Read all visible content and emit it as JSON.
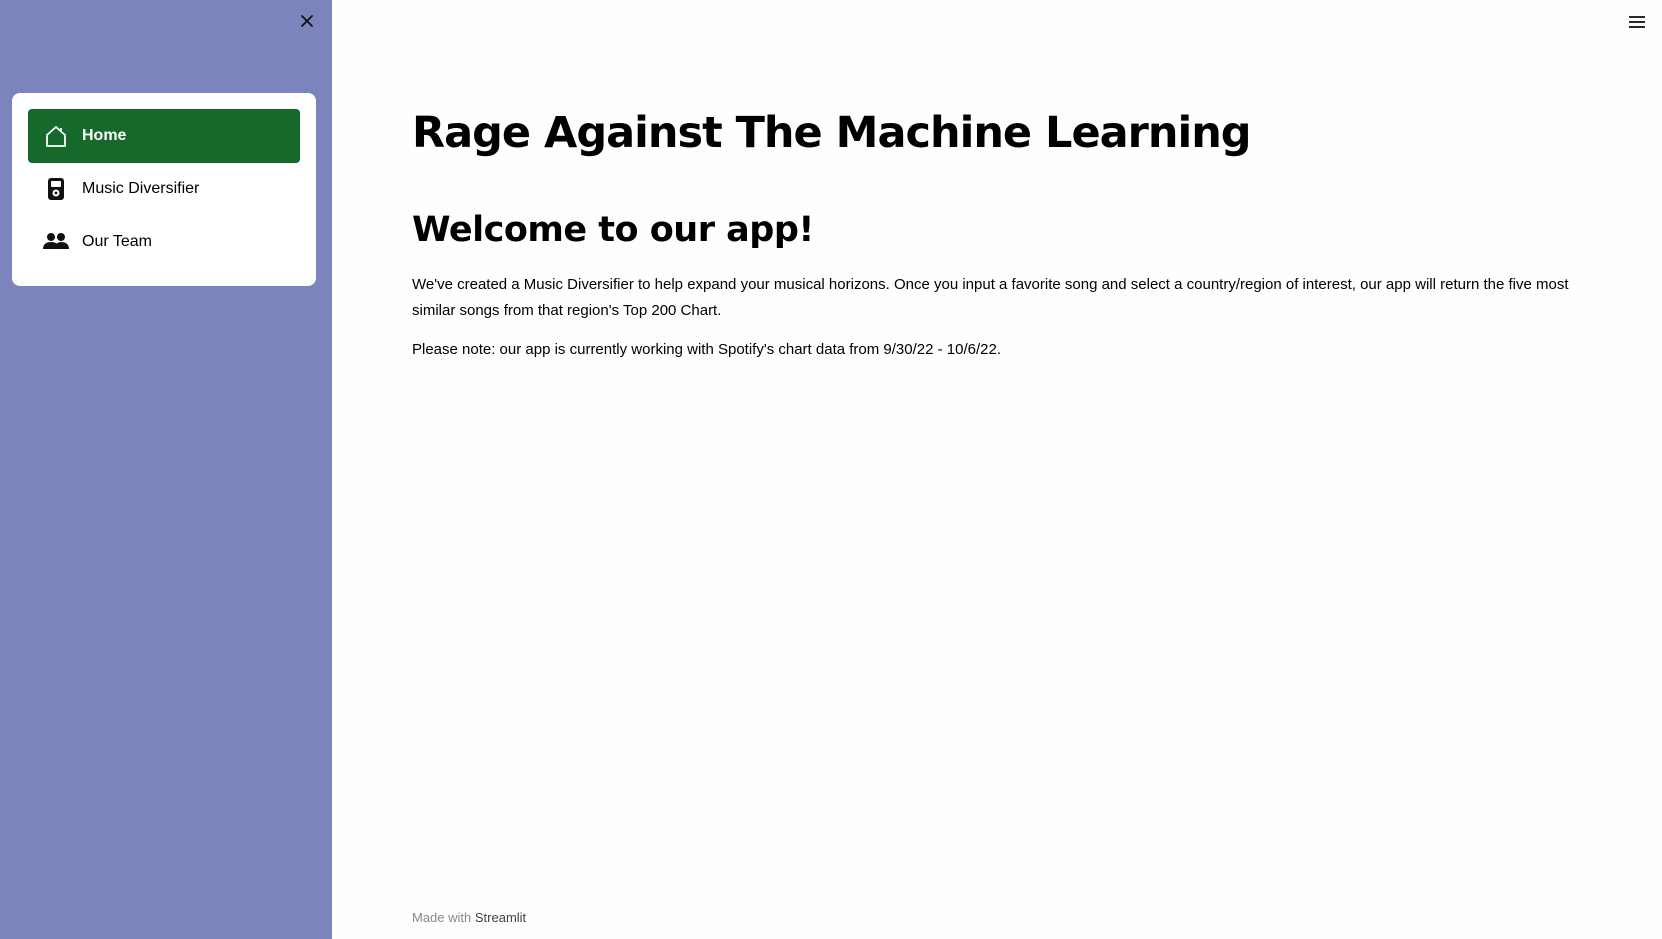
{
  "sidebar": {
    "close_icon": "close-icon",
    "background_color": "#7b84bd",
    "nav": [
      {
        "label": "Home",
        "icon": "home-icon",
        "active": true
      },
      {
        "label": "Music Diversifier",
        "icon": "music-player-icon",
        "active": false
      },
      {
        "label": "Our Team",
        "icon": "people-icon",
        "active": false
      }
    ],
    "active_color": "#16682b"
  },
  "header": {
    "menu_icon": "hamburger-menu-icon"
  },
  "main": {
    "title": "Rage Against The Machine Learning",
    "subtitle": "Welcome to our app!",
    "intro": "We've created a Music Diversifier to help expand your musical horizons. Once you input a favorite song and select a country/region of interest, our app will return the five most similar songs from that region's Top 200 Chart.",
    "note": "Please note: our app is currently working with Spotify's chart data from 9/30/22 - 10/6/22."
  },
  "footer": {
    "prefix": "Made with",
    "brand": "Streamlit"
  }
}
